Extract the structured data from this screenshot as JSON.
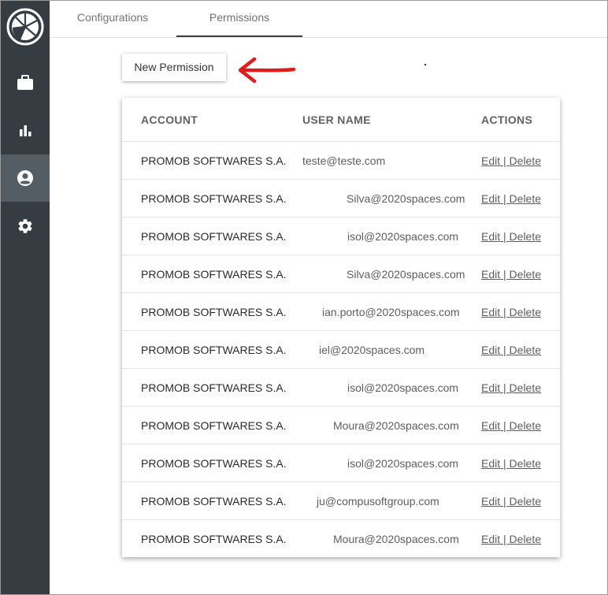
{
  "sidebar": {
    "logo": "brand-logo",
    "items": [
      {
        "icon": "briefcase-icon",
        "active": false
      },
      {
        "icon": "bar-chart-icon",
        "active": false
      },
      {
        "icon": "account-circle-icon",
        "active": true
      },
      {
        "icon": "gear-icon",
        "active": false
      }
    ]
  },
  "tabs": {
    "configurations": "Configurations",
    "permissions": "Permissions",
    "active": "permissions"
  },
  "toolbar": {
    "new_permission_label": "New Permission"
  },
  "annotation": {
    "arrow_color": "#e01d1d",
    "arrow": "arrow-left"
  },
  "table": {
    "headers": {
      "account": "ACCOUNT",
      "user": "USER NAME",
      "actions": "ACTIONS"
    },
    "rows": [
      {
        "account": "PROMOB SOFTWARES S.A.",
        "user": "teste@teste.com",
        "edit": "Edit",
        "sep": " | ",
        "delete": "Delete"
      },
      {
        "account": "PROMOB SOFTWARES S.A.",
        "user": "Silva@2020spaces.com",
        "edit": "Edit",
        "sep": " | ",
        "delete": "Delete"
      },
      {
        "account": "PROMOB SOFTWARES S.A.",
        "user": "isol@2020spaces.com",
        "edit": "Edit",
        "sep": " | ",
        "delete": "Delete"
      },
      {
        "account": "PROMOB SOFTWARES S.A.",
        "user": "Silva@2020spaces.com",
        "edit": "Edit",
        "sep": " | ",
        "delete": "Delete"
      },
      {
        "account": "PROMOB SOFTWARES S.A.",
        "user": "ian.porto@2020spaces.com",
        "edit": "Edit",
        "sep": " | ",
        "delete": "Delete"
      },
      {
        "account": "PROMOB SOFTWARES S.A.",
        "user": "iel@2020spaces.com",
        "edit": "Edit",
        "sep": " | ",
        "delete": "Delete"
      },
      {
        "account": "PROMOB SOFTWARES S.A.",
        "user": "isol@2020spaces.com",
        "edit": "Edit",
        "sep": " | ",
        "delete": "Delete"
      },
      {
        "account": "PROMOB SOFTWARES S.A.",
        "user": "Moura@2020spaces.com",
        "edit": "Edit",
        "sep": " | ",
        "delete": "Delete"
      },
      {
        "account": "PROMOB SOFTWARES S.A.",
        "user": "isol@2020spaces.com",
        "edit": "Edit",
        "sep": " | ",
        "delete": "Delete"
      },
      {
        "account": "PROMOB SOFTWARES S.A.",
        "user": "ju@compusoftgroup.com",
        "edit": "Edit",
        "sep": " | ",
        "delete": "Delete"
      },
      {
        "account": "PROMOB SOFTWARES S.A.",
        "user": "Moura@2020spaces.com",
        "edit": "Edit",
        "sep": " | ",
        "delete": "Delete"
      }
    ]
  }
}
